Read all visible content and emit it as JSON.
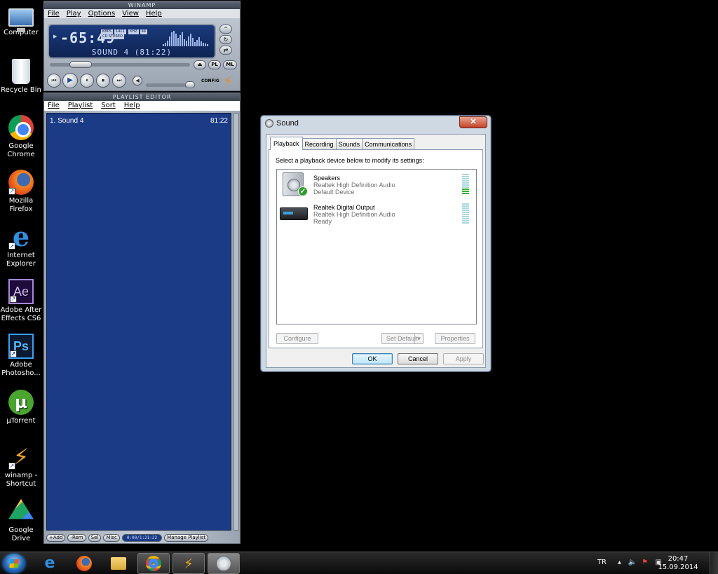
{
  "desktop": {
    "icons": [
      {
        "label": "Computer",
        "icon": "computer-icon"
      },
      {
        "label": "Recycle Bin",
        "icon": "recycle-bin-icon"
      },
      {
        "label": "Google Chrome",
        "icon": "chrome-icon"
      },
      {
        "label": "Mozilla Firefox",
        "icon": "firefox-icon"
      },
      {
        "label": "Internet Explorer",
        "icon": "ie-icon"
      },
      {
        "label": "Adobe After Effects CS6",
        "icon": "after-effects-icon",
        "glyph": "Ae"
      },
      {
        "label": "Adobe Photosho...",
        "icon": "photoshop-icon",
        "glyph": "Ps"
      },
      {
        "label": "µTorrent",
        "icon": "utorrent-icon",
        "glyph": "µ"
      },
      {
        "label": "winamp - Shortcut",
        "icon": "winamp-icon"
      },
      {
        "label": "Google Drive",
        "icon": "google-drive-icon"
      }
    ]
  },
  "winamp": {
    "title": "WINAMP",
    "menu": [
      "File",
      "Play",
      "Options",
      "View",
      "Help"
    ],
    "time": "-65:49",
    "kbps_label": "KBPS",
    "kbps": "1411",
    "khz_label": "KHZ",
    "khz": "44",
    "mode": "CD STEREO",
    "song": "SOUND 4 (81:22)",
    "pl_button": "PL",
    "ml_button": "ML",
    "config_label": "CONFIG",
    "controls": {
      "prev": "⏮",
      "play": "▶",
      "pause": "⏸",
      "stop": "⏹",
      "next": "⏭"
    }
  },
  "playlist": {
    "title": "PLAYLIST EDITOR",
    "menu": [
      "File",
      "Playlist",
      "Sort",
      "Help"
    ],
    "items": [
      {
        "title": "1. Sound 4",
        "duration": "81:22"
      }
    ],
    "footer": {
      "add": "+Add",
      "rem": "-Rem",
      "sel": "Sel",
      "misc": "Misc",
      "time": "0:00/1:21:22",
      "manage": "Manage Playlist"
    }
  },
  "sound_dialog": {
    "title": "Sound",
    "close": "✕",
    "tabs": [
      "Playback",
      "Recording",
      "Sounds",
      "Communications"
    ],
    "active_tab": "Playback",
    "intro": "Select a playback device below to modify its settings:",
    "devices": [
      {
        "name": "Speakers",
        "driver": "Realtek High Definition Audio",
        "status": "Default Device",
        "level": 0.3
      },
      {
        "name": "Realtek Digital Output",
        "driver": "Realtek High Definition Audio",
        "status": "Ready",
        "level": 0
      }
    ],
    "buttons": {
      "configure": "Configure",
      "set_default": "Set Default",
      "properties": "Properties",
      "ok": "OK",
      "cancel": "Cancel",
      "apply": "Apply"
    }
  },
  "taskbar": {
    "language": "TR",
    "time": "20:47",
    "date": "15.09.2014"
  }
}
